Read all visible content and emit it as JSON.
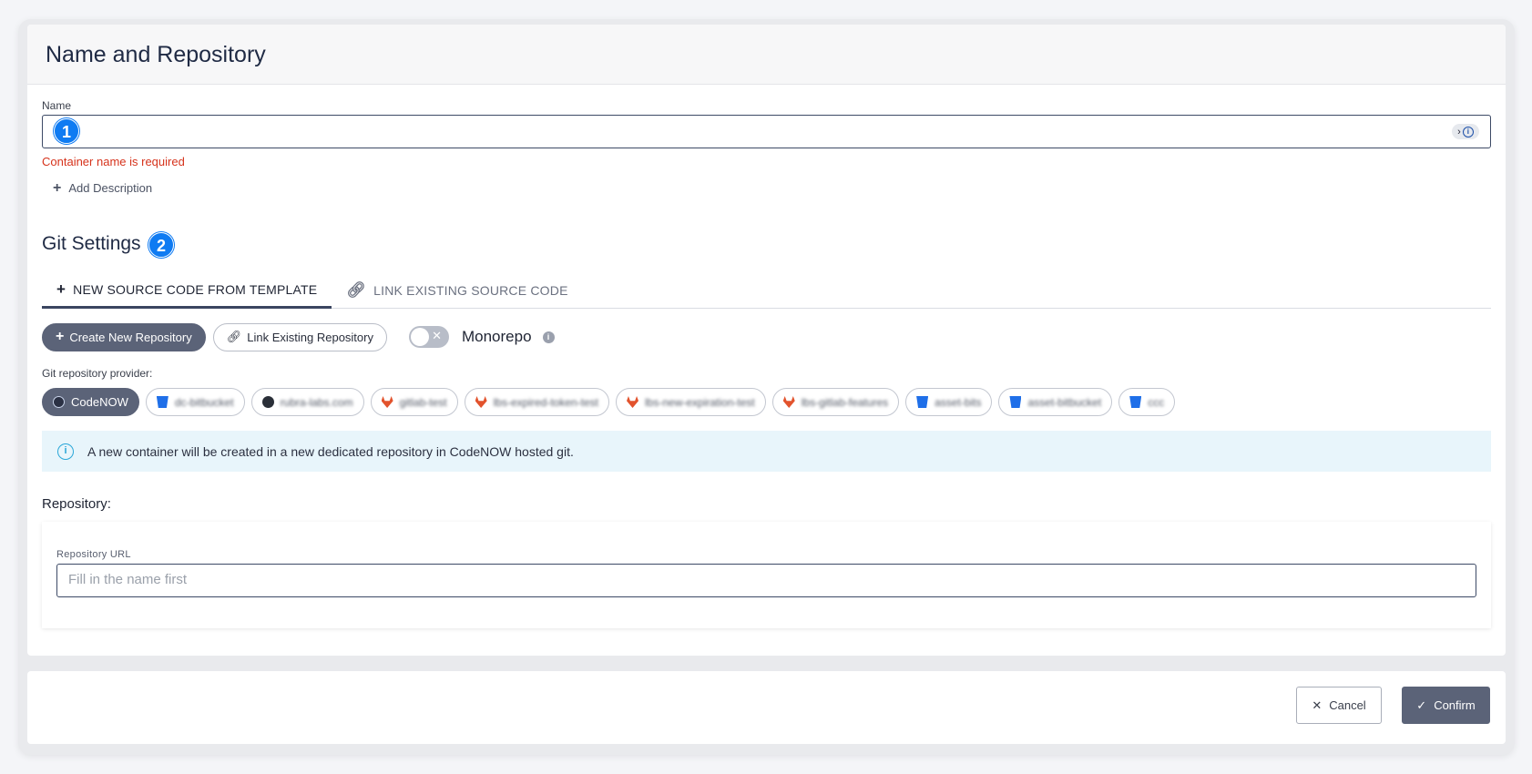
{
  "dialog": {
    "title": "Name and Repository"
  },
  "name_field": {
    "label": "Name",
    "value": "",
    "step_badge": "1",
    "error": "Container name is required"
  },
  "add_description_label": "Add Description",
  "git_settings": {
    "title": "Git Settings",
    "step_badge": "2",
    "tabs": [
      {
        "label": "NEW SOURCE CODE FROM TEMPLATE",
        "icon": "plus-icon",
        "active": true
      },
      {
        "label": "LINK EXISTING SOURCE CODE",
        "icon": "link-icon",
        "active": false
      }
    ],
    "create_repo_label": "Create New Repository",
    "link_repo_label": "Link Existing Repository",
    "monorepo_label": "Monorepo",
    "monorepo_enabled": false,
    "provider_label": "Git repository provider:",
    "providers": [
      {
        "label": "CodeNOW",
        "icon": "codenow-icon",
        "selected": true
      },
      {
        "label": "dc-bitbucket",
        "icon": "bitbucket-icon",
        "selected": false
      },
      {
        "label": "rubra-labs.com",
        "icon": "github-icon",
        "selected": false
      },
      {
        "label": "gitlab-test",
        "icon": "gitlab-icon",
        "selected": false
      },
      {
        "label": "lbs-expired-token-test",
        "icon": "gitlab-icon",
        "selected": false
      },
      {
        "label": "lbs-new-expiration-test",
        "icon": "gitlab-icon",
        "selected": false
      },
      {
        "label": "lbs-gitlab-features",
        "icon": "gitlab-icon",
        "selected": false
      },
      {
        "label": "asset-bits",
        "icon": "bitbucket-icon",
        "selected": false
      },
      {
        "label": "asset-bitbucket",
        "icon": "bitbucket-icon",
        "selected": false
      },
      {
        "label": "ccc",
        "icon": "bitbucket-icon",
        "selected": false
      }
    ],
    "info_message": "A new container will be created in a new dedicated repository in CodeNOW hosted git."
  },
  "repository": {
    "title": "Repository:",
    "url_label": "Repository URL",
    "url_placeholder": "Fill in the name first"
  },
  "footer": {
    "cancel_label": "Cancel",
    "confirm_label": "Confirm"
  },
  "colors": {
    "primary_dark": "#5b6378",
    "badge_blue": "#0f7bf2",
    "error_red": "#d6331c",
    "info_bg": "#e8f5fb"
  }
}
